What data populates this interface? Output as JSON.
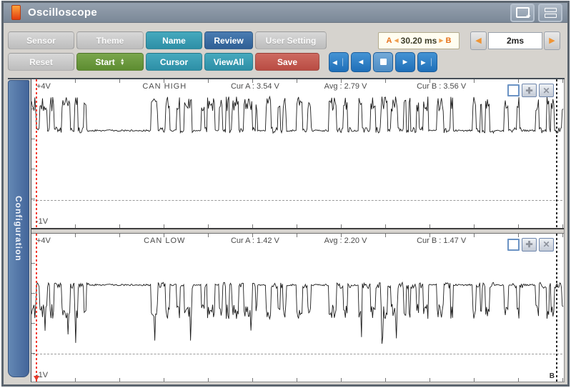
{
  "window": {
    "title": "Oscilloscope"
  },
  "toolbar": {
    "row1": [
      {
        "label": "Sensor"
      },
      {
        "label": "Theme"
      },
      {
        "label": "Name"
      },
      {
        "label": "Review"
      },
      {
        "label": "User Setting"
      }
    ],
    "row2": [
      {
        "label": "Reset"
      },
      {
        "label": "Start"
      },
      {
        "label": "Cursor"
      },
      {
        "label": "ViewAll"
      },
      {
        "label": "Save"
      }
    ],
    "cursor_readout": {
      "a_label": "A",
      "value": "30.20 ms",
      "b_label": "B"
    },
    "timebase": {
      "value": "2ms"
    }
  },
  "sidebar": {
    "label": "Configuration"
  },
  "panels": [
    {
      "title": "CAN HIGH",
      "top_label": "+4V",
      "bottom_label": "-1V",
      "cur_a": "Cur A : 3.54 V",
      "avg": "Avg : 2.79 V",
      "cur_b": "Cur B : 3.56 V"
    },
    {
      "title": "CAN LOW",
      "top_label": "+4V",
      "bottom_label": "-1V",
      "cur_a": "Cur A : 1.42 V",
      "avg": "Avg : 2.20 V",
      "cur_b": "Cur B : 1.47 V",
      "b_marker": "B"
    }
  ],
  "chart_data": {
    "type": "line",
    "title": "CAN bus differential pair waveforms",
    "x_span": "30.20 ms between cursor A and cursor B, timebase 2ms",
    "y_range_volts": [
      -1,
      4
    ],
    "zero_line_frac": 0.813,
    "series": [
      {
        "name": "CAN HIGH",
        "idle_v": 2.5,
        "dominant_v": 3.5,
        "cur_a_v": 3.54,
        "avg_v": 2.79,
        "cur_b_v": 3.56
      },
      {
        "name": "CAN LOW",
        "idle_v": 2.5,
        "dominant_v": 1.5,
        "cur_a_v": 1.42,
        "avg_v": 2.2,
        "cur_b_v": 1.47
      }
    ],
    "burst_windows": [
      [
        0.0,
        0.11
      ],
      [
        0.225,
        0.26
      ],
      [
        0.272,
        0.303
      ],
      [
        0.318,
        0.345
      ],
      [
        0.352,
        0.425
      ],
      [
        0.44,
        0.478
      ],
      [
        0.497,
        0.527
      ],
      [
        0.558,
        0.6
      ],
      [
        0.615,
        0.745
      ],
      [
        0.762,
        0.792
      ],
      [
        0.828,
        0.868
      ],
      [
        0.888,
        0.922
      ],
      [
        0.947,
        1.0
      ]
    ],
    "seed": 20101
  },
  "colors": {
    "trace": "#1c1c1c",
    "cursor_a": "#f43b2d",
    "cursor_b": "#2b2b2b",
    "accent_teal": "#2d8fa6",
    "accent_blue": "#2f5f95",
    "accent_green": "#5d8c31",
    "accent_red": "#b94c43",
    "accent_orange": "#e6731c"
  }
}
